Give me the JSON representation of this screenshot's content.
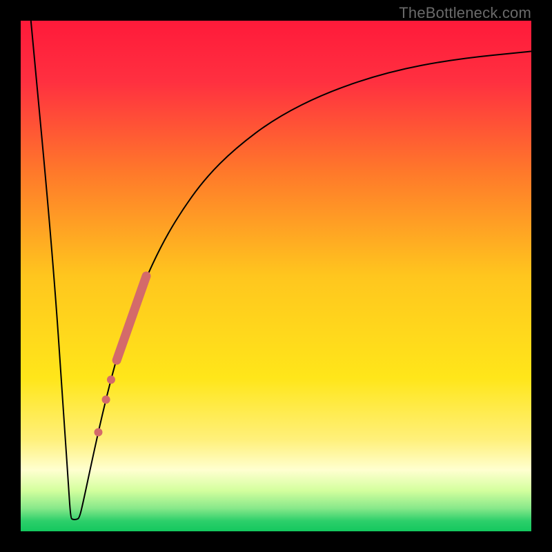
{
  "watermark": "TheBottleneck.com",
  "chart_data": {
    "type": "line",
    "title": "",
    "xlabel": "",
    "ylabel": "",
    "xlim": [
      0,
      100
    ],
    "ylim": [
      0,
      100
    ],
    "background_gradient": {
      "stops": [
        {
          "offset": 0.0,
          "color": "#ff1a3a"
        },
        {
          "offset": 0.12,
          "color": "#ff3040"
        },
        {
          "offset": 0.3,
          "color": "#ff7a2a"
        },
        {
          "offset": 0.5,
          "color": "#ffc61e"
        },
        {
          "offset": 0.7,
          "color": "#ffe61a"
        },
        {
          "offset": 0.82,
          "color": "#fff07a"
        },
        {
          "offset": 0.88,
          "color": "#ffffd0"
        },
        {
          "offset": 0.92,
          "color": "#d4ff9e"
        },
        {
          "offset": 0.955,
          "color": "#87e88a"
        },
        {
          "offset": 0.98,
          "color": "#2ccf6a"
        },
        {
          "offset": 1.0,
          "color": "#14c85e"
        }
      ]
    },
    "series": [
      {
        "name": "bottleneck-curve",
        "color": "#000000",
        "width": 2.0,
        "points": [
          {
            "x": 2,
            "y": 100
          },
          {
            "x": 6.2,
            "y": 55
          },
          {
            "x": 8.5,
            "y": 22
          },
          {
            "x": 9.4,
            "y": 8
          },
          {
            "x": 9.8,
            "y": 2.6
          },
          {
            "x": 10.2,
            "y": 2.3
          },
          {
            "x": 10.9,
            "y": 2.3
          },
          {
            "x": 11.5,
            "y": 2.6
          },
          {
            "x": 12.3,
            "y": 6
          },
          {
            "x": 14.0,
            "y": 14
          },
          {
            "x": 16.0,
            "y": 23
          },
          {
            "x": 18.0,
            "y": 31
          },
          {
            "x": 20.0,
            "y": 38
          },
          {
            "x": 23.0,
            "y": 46
          },
          {
            "x": 27.0,
            "y": 55
          },
          {
            "x": 31.0,
            "y": 62
          },
          {
            "x": 36.0,
            "y": 69
          },
          {
            "x": 42.0,
            "y": 75
          },
          {
            "x": 50.0,
            "y": 81
          },
          {
            "x": 60.0,
            "y": 86
          },
          {
            "x": 72.0,
            "y": 90
          },
          {
            "x": 85.0,
            "y": 92.5
          },
          {
            "x": 100.0,
            "y": 94
          }
        ]
      }
    ],
    "markers": {
      "name": "sample-points",
      "color": "#d46a6a",
      "radius": 6,
      "pill": {
        "x1": 18.8,
        "y1": 33.5,
        "x2": 24.6,
        "y2": 50.0,
        "width": 13
      },
      "points": [
        {
          "x": 17.7,
          "y": 29.7
        },
        {
          "x": 16.7,
          "y": 25.8
        },
        {
          "x": 15.2,
          "y": 19.4
        }
      ]
    }
  }
}
